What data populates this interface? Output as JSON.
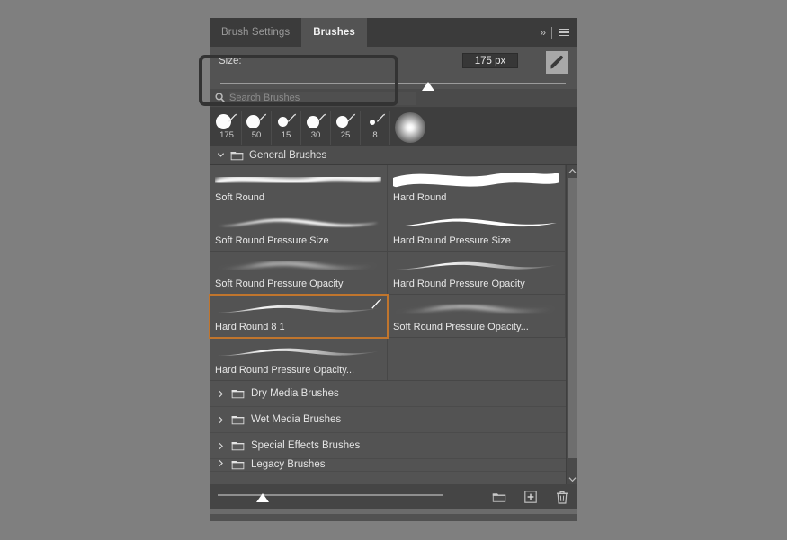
{
  "app": {
    "panel_title": "Brushes",
    "background_color": "#7f7f7f",
    "panel_bg": "#535353",
    "accent_color": "#c0752d"
  },
  "tabs": [
    {
      "label": "Brush Settings",
      "active": false,
      "name": "tab-brush-settings"
    },
    {
      "label": "Brushes",
      "active": true,
      "name": "tab-brushes"
    }
  ],
  "tabbar_controls": {
    "collapse_label": "»",
    "collapse_icon": "double-chevron-right-icon",
    "menu_icon": "hamburger-menu-icon"
  },
  "size_control": {
    "label": "Size:",
    "value": "175 px",
    "slider_percent": 60,
    "brush_toggle_icon": "paintbrush-icon"
  },
  "search": {
    "placeholder": "Search Brushes",
    "value": "",
    "icon": "search-icon"
  },
  "recent_presets": [
    {
      "label": "175",
      "dot": 17
    },
    {
      "label": "50",
      "dot": 15
    },
    {
      "label": "15",
      "dot": 11
    },
    {
      "label": "30",
      "dot": 14
    },
    {
      "label": "25",
      "dot": 13
    },
    {
      "label": "8",
      "dot": 6
    }
  ],
  "active_brush_preview": "soft-round-brush-preview",
  "group": {
    "title": "General Brushes",
    "expanded": true,
    "caret_icon": "chevron-down-icon",
    "folder_icon": "folder-open-icon"
  },
  "brushes": [
    {
      "name": "Soft Round",
      "style": "soft",
      "selected": false
    },
    {
      "name": "Hard Round",
      "style": "hard",
      "selected": false
    },
    {
      "name": "Soft Round Pressure Size",
      "style": "soft-taper",
      "selected": false
    },
    {
      "name": "Hard Round Pressure Size",
      "style": "hard-taper",
      "selected": false
    },
    {
      "name": "Soft Round Pressure Opacity",
      "style": "soft-fade",
      "selected": false
    },
    {
      "name": "Hard Round Pressure Opacity",
      "style": "hard-fade",
      "selected": false
    },
    {
      "name": "Hard Round 8 1",
      "style": "hard-fade",
      "selected": true
    },
    {
      "name": "Soft Round Pressure Opacity...",
      "style": "soft-fade",
      "selected": false
    },
    {
      "name": "Hard Round Pressure Opacity...",
      "style": "hard-fade",
      "selected": false
    }
  ],
  "folders": [
    {
      "label": "Dry Media Brushes",
      "expanded": false
    },
    {
      "label": "Wet Media Brushes",
      "expanded": false
    },
    {
      "label": "Special Effects Brushes",
      "expanded": false
    },
    {
      "label": "Legacy Brushes",
      "expanded": false
    }
  ],
  "bottom_bar": {
    "slider_percent": 20,
    "new_group_icon": "new-folder-icon",
    "new_brush_icon": "new-brush-icon",
    "delete_icon": "trash-icon"
  },
  "annotation": {
    "target": "size-slider-highlight",
    "color": "#333333"
  }
}
